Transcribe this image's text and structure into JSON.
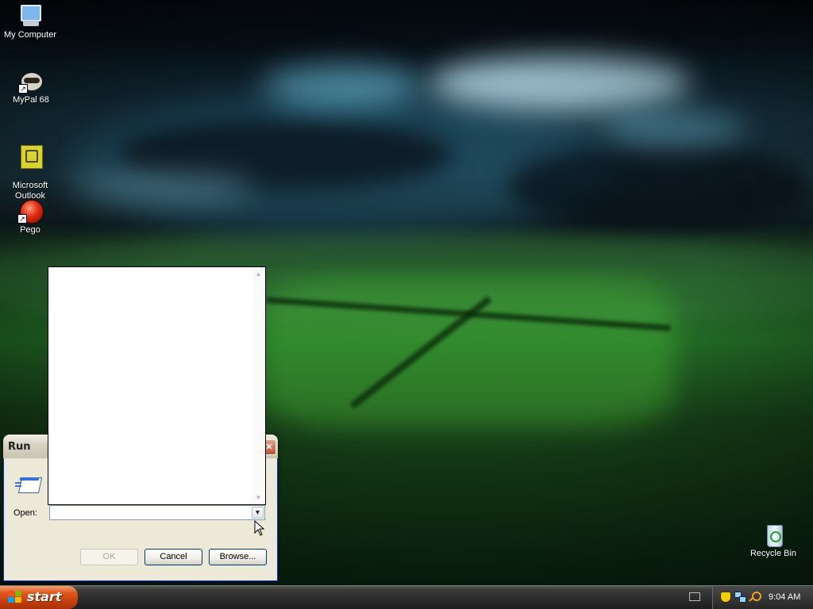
{
  "desktop": {
    "icons": [
      {
        "label": "My Computer",
        "icon": "computer-icon"
      },
      {
        "label": "MyPal 68",
        "icon": "mypal-browser-icon"
      },
      {
        "label": "Microsoft\nOutlook",
        "icon": "outlook-icon"
      },
      {
        "label": "Pego",
        "icon": "pego-icon"
      }
    ],
    "recycle_bin": {
      "label": "Recycle Bin",
      "icon": "recycle-bin-icon"
    }
  },
  "run_dialog": {
    "title": "Run",
    "close_glyph": "✕",
    "open_label": "Open:",
    "open_value": "",
    "buttons": {
      "ok": "OK",
      "cancel": "Cancel",
      "browse": "Browse..."
    }
  },
  "dropdown": {
    "items": []
  },
  "taskbar": {
    "start_label": "start",
    "clock": "9:04 AM",
    "tray_icons": [
      "security-shield-icon",
      "network-icon",
      "search-icon"
    ],
    "accent": "#e0581e"
  }
}
